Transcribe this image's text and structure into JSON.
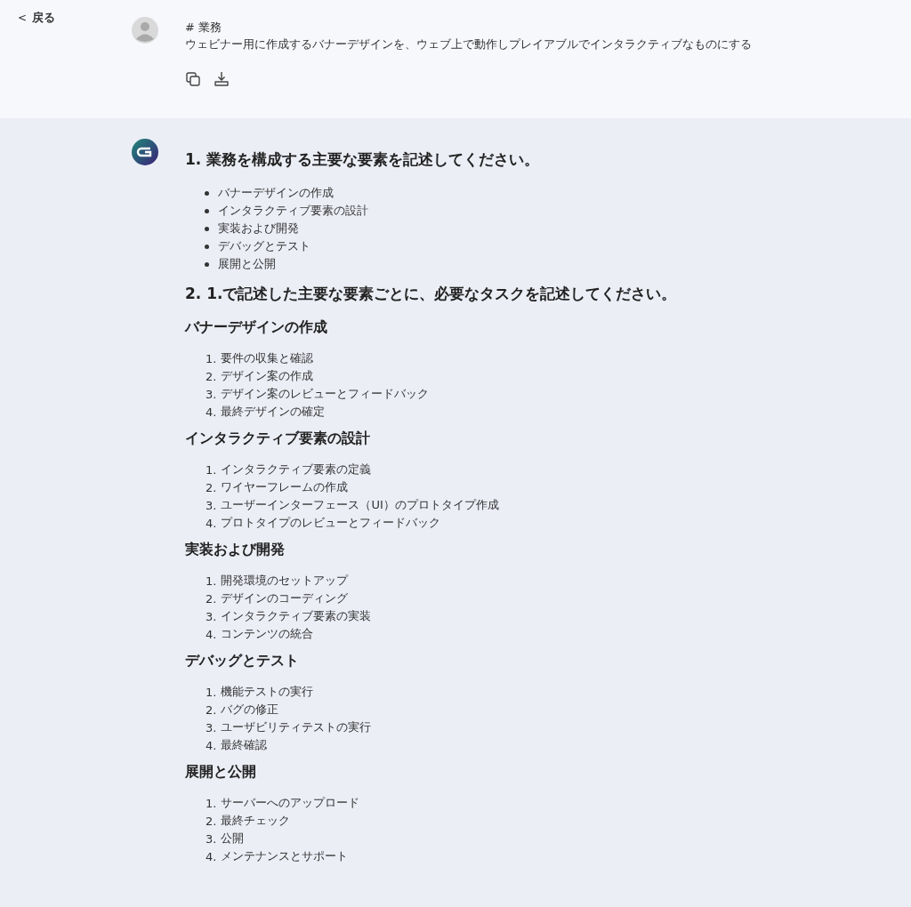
{
  "back_link": {
    "icon": "<",
    "label": "戻る"
  },
  "user_message": {
    "title": "# 業務",
    "text": "ウェビナー用に作成するバナーデザインを、ウェブ上で動作しプレイアブルでインタラクティブなものにする"
  },
  "reply": [
    {
      "kind": "heading",
      "text": "1. 業務を構成する主要な要素を記述してください。"
    },
    {
      "kind": "bullets",
      "items": [
        "バナーデザインの作成",
        "インタラクティブ要素の設計",
        "実装および開発",
        "デバッグとテスト",
        "展開と公開"
      ]
    },
    {
      "kind": "heading",
      "text": "2. 1.で記述した主要な要素ごとに、必要なタスクを記述してください。"
    },
    {
      "kind": "subheading",
      "text": "バナーデザインの作成"
    },
    {
      "kind": "numbered",
      "items": [
        {
          "number": "1.",
          "text": "要件の収集と確認"
        },
        {
          "number": "2.",
          "text": "デザイン案の作成"
        },
        {
          "number": "3.",
          "text": "デザイン案のレビューとフィードバック"
        },
        {
          "number": "4.",
          "text": "最終デザインの確定"
        }
      ]
    },
    {
      "kind": "subheading",
      "text": "インタラクティブ要素の設計"
    },
    {
      "kind": "numbered",
      "items": [
        {
          "number": "1.",
          "text": "インタラクティブ要素の定義"
        },
        {
          "number": "2.",
          "text": "ワイヤーフレームの作成"
        },
        {
          "number": "3.",
          "text": "ユーザーインターフェース（UI）のプロトタイプ作成"
        },
        {
          "number": "4.",
          "text": "プロトタイプのレビューとフィードバック"
        }
      ]
    },
    {
      "kind": "subheading",
      "text": "実装および開発"
    },
    {
      "kind": "numbered",
      "items": [
        {
          "number": "1.",
          "text": "開発環境のセットアップ"
        },
        {
          "number": "2.",
          "text": "デザインのコーディング"
        },
        {
          "number": "3.",
          "text": "インタラクティブ要素の実装"
        },
        {
          "number": "4.",
          "text": "コンテンツの統合"
        }
      ]
    },
    {
      "kind": "subheading",
      "text": "デバッグとテスト"
    },
    {
      "kind": "numbered",
      "items": [
        {
          "number": "1.",
          "text": "機能テストの実行"
        },
        {
          "number": "2.",
          "text": "バグの修正"
        },
        {
          "number": "3.",
          "text": "ユーザビリティテストの実行"
        },
        {
          "number": "4.",
          "text": "最終確認"
        }
      ]
    },
    {
      "kind": "subheading",
      "text": "展開と公開"
    },
    {
      "kind": "numbered",
      "items": [
        {
          "number": "1.",
          "text": "サーバーへのアップロード"
        },
        {
          "number": "2.",
          "text": "最終チェック"
        },
        {
          "number": "3.",
          "text": "公開"
        },
        {
          "number": "4.",
          "text": "メンテナンスとサポート"
        }
      ]
    }
  ]
}
